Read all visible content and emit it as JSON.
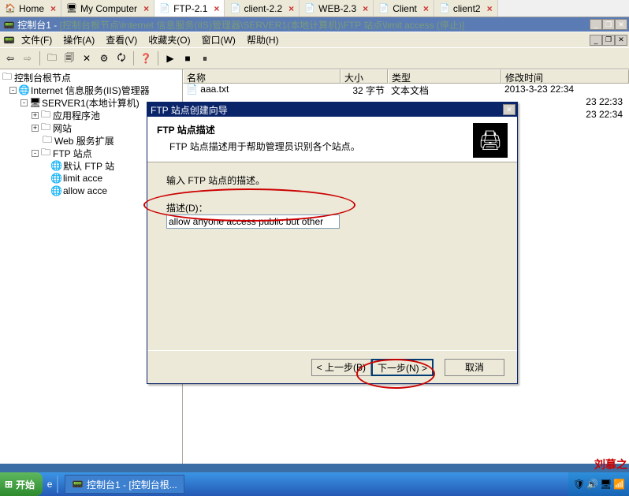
{
  "vm_tabs": [
    {
      "label": "Home",
      "icon": "🏠"
    },
    {
      "label": "My Computer",
      "icon": "🖥"
    },
    {
      "label": "FTP-2.1",
      "icon": "📄",
      "active": true
    },
    {
      "label": "client-2.2",
      "icon": "📄"
    },
    {
      "label": "WEB-2.3",
      "icon": "📄"
    },
    {
      "label": "Client",
      "icon": "📄"
    },
    {
      "label": "client2",
      "icon": "📄"
    }
  ],
  "mdi": {
    "app": "控制台1 - ",
    "path": "[控制台根节点\\Internet 信息服务(IIS)管理器\\SERVER1(本地计算机)\\FTP 站点\\limit access (停止)]"
  },
  "menu": {
    "file": "文件(F)",
    "action": "操作(A)",
    "view": "查看(V)",
    "fav": "收藏夹(O)",
    "window": "窗口(W)",
    "help": "帮助(H)"
  },
  "tree": {
    "root": "控制台根节点",
    "iis": "Internet 信息服务(IIS)管理器",
    "server": "SERVER1(本地计算机)",
    "apppool": "应用程序池",
    "web": "网站",
    "webext": "Web 服务扩展",
    "ftp": "FTP 站点",
    "ftp_default": "默认 FTP 站",
    "ftp_limit": "limit acce",
    "ftp_allow": "allow acce"
  },
  "list": {
    "headers": {
      "name": "名称",
      "size": "大小",
      "type": "类型",
      "modified": "修改时间"
    },
    "col_widths": {
      "name": "200px",
      "size": "60px",
      "type": "144px",
      "modified": "150px"
    },
    "rows": [
      {
        "name": "aaa.txt",
        "size": "32 字节",
        "type": "文本文档",
        "modified": "2013-3-23 22:34"
      }
    ],
    "extra_times": [
      "23 22:33",
      "23 22:34"
    ]
  },
  "wizard": {
    "title": "FTP 站点创建向导",
    "heading": "FTP 站点描述",
    "subheading": "FTP 站点描述用于帮助管理员识别各个站点。",
    "prompt": "输入 FTP 站点的描述。",
    "field_label": "描述(D)：",
    "field_value": "allow anyone access public but other",
    "back": "< 上一步(B)",
    "next": "下一步(N) >",
    "cancel": "取消"
  },
  "taskbar": {
    "start": "开始",
    "task1": "控制台1 - [控制台根..."
  },
  "signature": "刘慕之"
}
